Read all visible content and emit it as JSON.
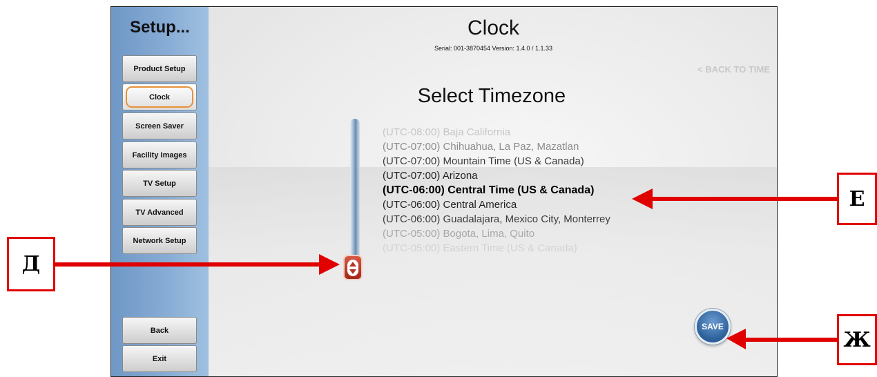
{
  "sidebar": {
    "title": "Setup...",
    "buttons": [
      "Product Setup",
      "Clock",
      "Screen Saver",
      "Facility Images",
      "TV Setup",
      "TV Advanced",
      "Network Setup"
    ],
    "active": "Clock",
    "back_label": "Back",
    "exit_label": "Exit"
  },
  "header": {
    "title": "Clock",
    "serial_line": "Serial: 001-3870454   Version: 1.4.0 / 1.1.33"
  },
  "back_link": "< BACK TO TIME",
  "select_heading": "Select Timezone",
  "timezones": [
    "(UTC-08:00) Baja California",
    "(UTC-07:00) Chihuahua, La Paz, Mazatlan",
    "(UTC-07:00) Mountain Time (US & Canada)",
    "(UTC-07:00) Arizona",
    "(UTC-06:00) Central Time (US & Canada)",
    "(UTC-06:00) Central America",
    "(UTC-06:00) Guadalajara, Mexico City, Monterrey",
    "(UTC-05:00) Bogota, Lima, Quito",
    "(UTC-05:00) Eastern Time (US & Canada)"
  ],
  "selected_timezone": "(UTC-06:00) Central Time (US & Canada)",
  "save_label": "SAVE",
  "annotations": {
    "scroll_label": "Д",
    "timezone_label": "Е",
    "save_label": "Ж"
  },
  "colors": {
    "sidebar_blue": "#7fa6d2",
    "active_outline": "#e79237",
    "scroll_handle": "#b23422",
    "save_button": "#2c5f99",
    "annotation_red": "#e10000"
  }
}
